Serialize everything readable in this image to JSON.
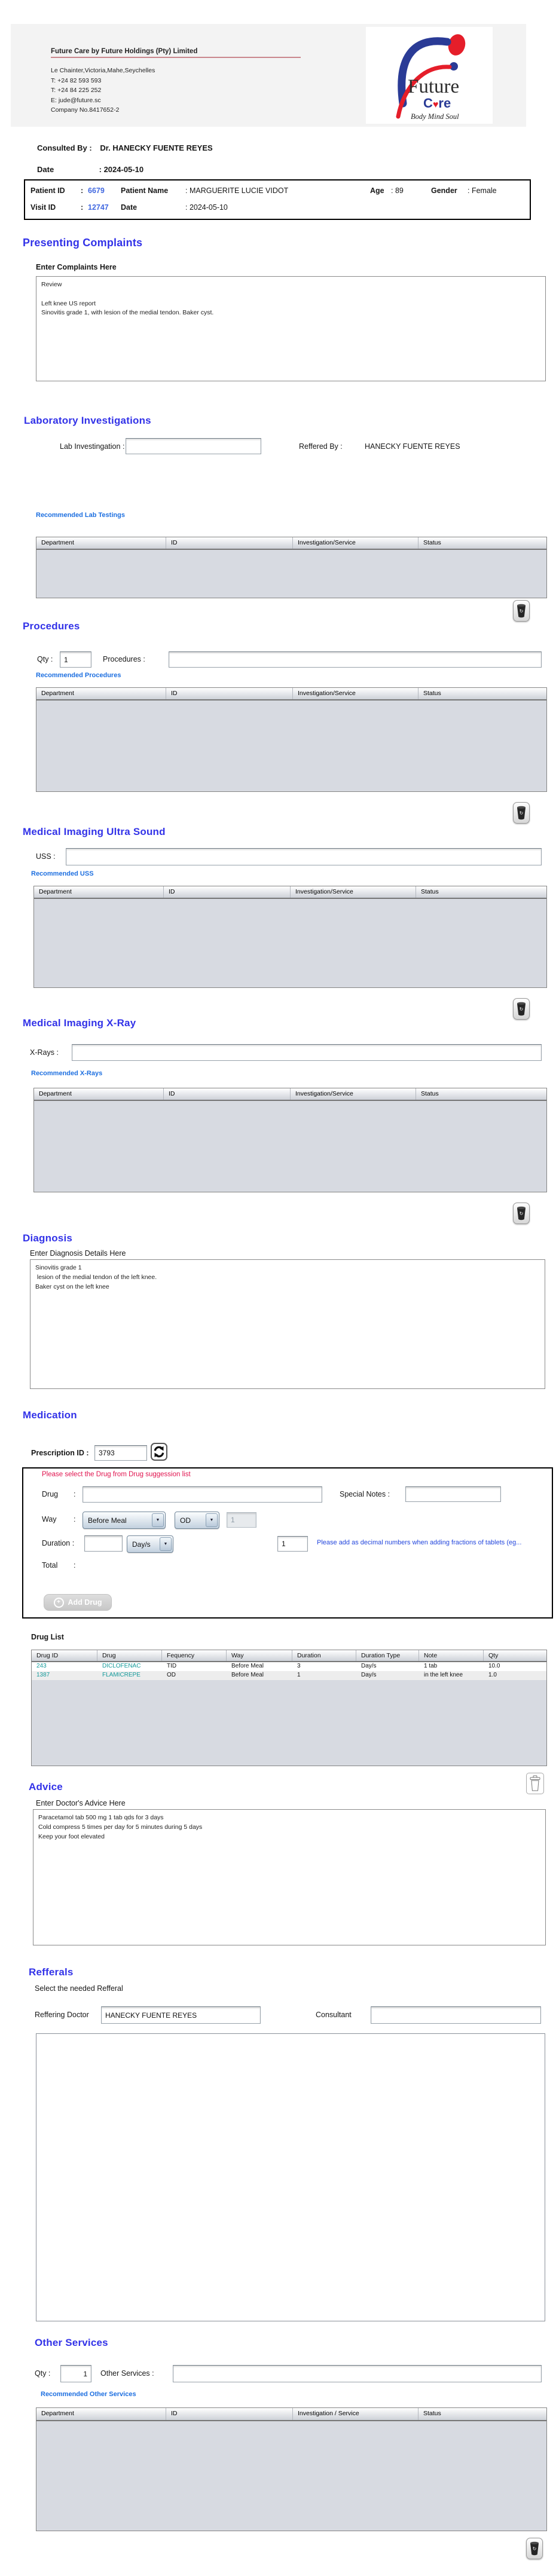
{
  "company": {
    "name": "Future Care by Future Holdings (Pty) Limited",
    "address": "Le Chainter,Victoria,Mahe,Seychelles",
    "phone1": "T: +24  82 593 593",
    "phone2": "T: +24  84 225 252",
    "email": "E: jude@future.sc",
    "company_no": "Company No.8417652-2"
  },
  "logo": {
    "future": "Future",
    "care_c": "C",
    "care_heart": "♥",
    "care_re": "re",
    "tagline": "Body Mind Soul"
  },
  "consult": {
    "consulted_by_label": "Consulted By  :",
    "consulted_by_value": "Dr.  HANECKY FUENTE REYES",
    "date_label": "Date",
    "date_value": ": 2024-05-10"
  },
  "patient": {
    "patient_id_label": "Patient ID",
    "patient_id_colon": ":",
    "patient_id": "6679",
    "patient_name_label": "Patient Name",
    "patient_name": ": MARGUERITE LUCIE VIDOT",
    "age_label": "Age",
    "age": ": 89",
    "gender_label": "Gender",
    "gender": ": Female",
    "visit_id_label": "Visit ID",
    "visit_id_colon": ":",
    "visit_id": "12747",
    "visit_date_label": "Date",
    "visit_date": ": 2024-05-10"
  },
  "complaints": {
    "title": "Presenting Complaints",
    "sublabel": "Enter Complaints Here",
    "text": "Review\n\nLeft knee US report\nSinovitis grade 1, with lesion of the medial tendon. Baker cyst."
  },
  "lab": {
    "title": "Laboratory  Investigations",
    "field_label": "Lab Investingation :",
    "field_value": "",
    "reffered_label": "Reffered By :",
    "reffered_value": "HANECKY FUENTE REYES",
    "link": "Recommended Lab Testings",
    "headers": [
      "Department",
      "ID",
      "Investigation/Service",
      "Status"
    ]
  },
  "procedures": {
    "title": "Procedures",
    "qty_label": "Qty :",
    "qty_value": "1",
    "field_label": "Procedures :",
    "field_value": "",
    "link": "Recommended Procedures",
    "headers": [
      "Department",
      "ID",
      "Investigation/Service",
      "Status"
    ]
  },
  "uss": {
    "title": "Medical Imaging Ultra Sound",
    "field_label": "USS :",
    "field_value": "",
    "link": "Recommended USS",
    "headers": [
      "Department",
      "ID",
      "Investigation/Service",
      "Status"
    ]
  },
  "xray": {
    "title": "Medical Imaging X-Ray",
    "field_label": "X-Rays :",
    "field_value": "",
    "link": "Recommended X-Rays",
    "headers": [
      "Department",
      "ID",
      "Investigation/Service",
      "Status"
    ]
  },
  "diagnosis": {
    "title": "Diagnosis",
    "sublabel": "Enter Diagnosis Details Here",
    "text": "Sinovitis grade 1\n lesion of the medial tendon of the left knee.\nBaker cyst on the left knee"
  },
  "medication": {
    "title": "Medication",
    "prescription_label": "Prescription ID :",
    "prescription_id": "3793",
    "warning": "Please select the Drug from Drug suggession list",
    "drug_label": "Drug",
    "colon": ":",
    "drug_value": "",
    "special_notes_label": "Special Notes  :",
    "special_notes_value": "",
    "way_label": "Way",
    "way_value": "Before Meal",
    "frequency_value": "OD",
    "dose_value": "1",
    "duration_label": "Duration :",
    "duration_value": "",
    "duration_type_value": "Day/s",
    "tablets_value": "1",
    "hint": "Please add as decimal numbers when adding fractions of tablets (eg...",
    "total_label": "Total",
    "add_drug_label": "Add Drug",
    "drug_list_label": "Drug List",
    "drug_table": {
      "headers": [
        "Drug ID",
        "Drug",
        "Fequency",
        "Way",
        "Duration",
        "Duration Type",
        "Note",
        "Qty"
      ],
      "rows": [
        [
          "243",
          "DICLOFENAC",
          "TID",
          "Before Meal",
          "3",
          "Day/s",
          "1 tab",
          "10.0"
        ],
        [
          "1387",
          "FLAMICREPE",
          "OD",
          "Before Meal",
          "1",
          "Day/s",
          "in the left knee",
          "1.0"
        ]
      ]
    }
  },
  "advice": {
    "title": "Advice",
    "sublabel": "Enter Doctor's Advice Here",
    "text": "Paracetamol tab 500 mg 1 tab qds for 3 days\nCold compress 5 times per day for 5 minutes during 5 days\nKeep your foot elevated"
  },
  "refferals": {
    "title": "Refferals",
    "sublabel": "Select the needed Refferal",
    "doctor_label": "Reffering Doctor",
    "doctor_value": "HANECKY FUENTE REYES",
    "consultant_label": "Consultant",
    "consultant_value": ""
  },
  "other_services": {
    "title": "Other Services",
    "qty_label": "Qty :",
    "qty_value": "1",
    "field_label": "Other Services :",
    "field_value": "",
    "link": "Recommended Other Services",
    "headers": [
      "Department",
      "ID",
      "Investigation / Service",
      "Status"
    ]
  }
}
